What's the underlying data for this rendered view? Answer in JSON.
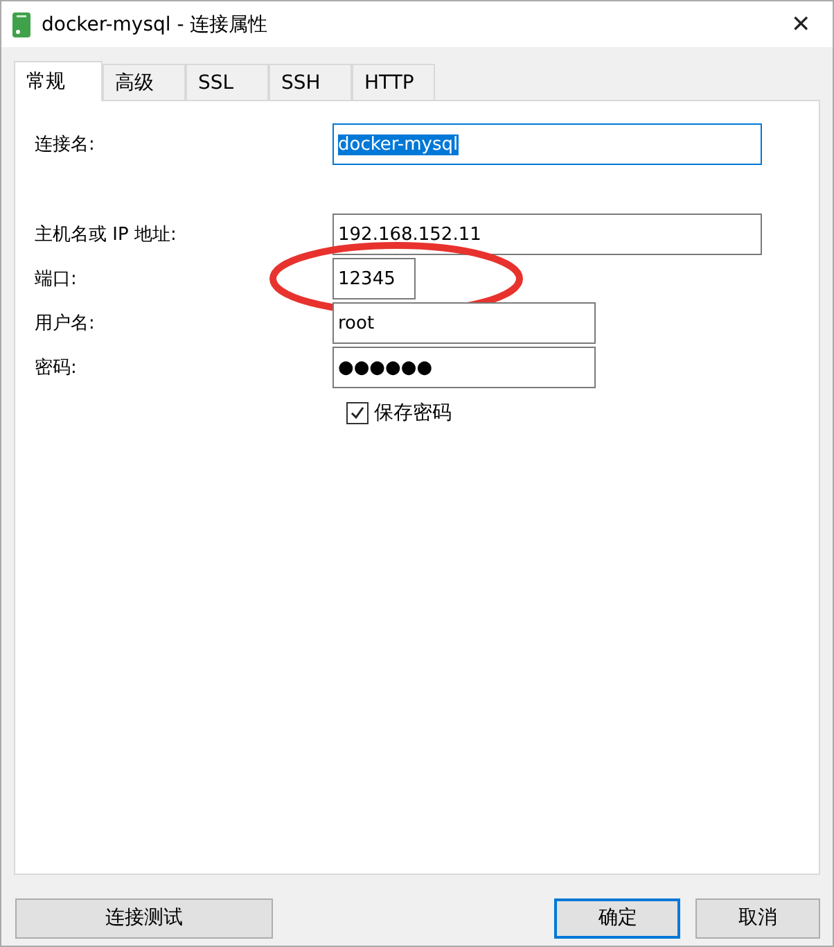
{
  "window": {
    "title": "docker-mysql - 连接属性",
    "close": "✕"
  },
  "tabs": [
    {
      "label": "常规",
      "selected": true
    },
    {
      "label": "高级",
      "selected": false
    },
    {
      "label": "SSL",
      "selected": false
    },
    {
      "label": "SSH",
      "selected": false
    },
    {
      "label": "HTTP",
      "selected": false
    }
  ],
  "name_field": {
    "label": "连接名:",
    "value": "docker-mysql",
    "kind": "wide",
    "focused": true
  },
  "fields": [
    {
      "label": "主机名或 IP 地址:",
      "value": "192.168.152.11",
      "kind": "wide",
      "focused": false
    },
    {
      "label": "端口:",
      "value": "12345",
      "kind": "narrow",
      "focused": false,
      "circled": true
    },
    {
      "label": "用户名:",
      "value": "root",
      "kind": "medium",
      "focused": false
    },
    {
      "label": "密码:",
      "value": "●●●●●●",
      "kind": "medium",
      "focused": false
    }
  ],
  "save_password": {
    "label": "保存密码",
    "checked": true
  },
  "buttons": {
    "test": "连接测试",
    "ok": "确定",
    "cancel": "取消"
  }
}
